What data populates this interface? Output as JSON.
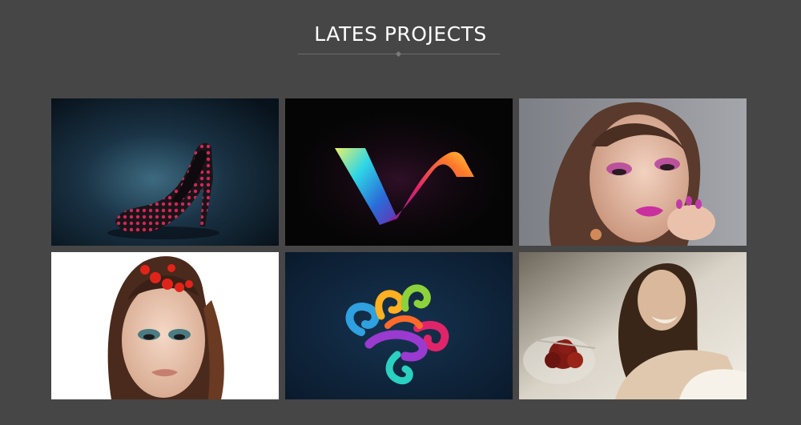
{
  "section": {
    "title": "LATES PROJECTS"
  },
  "projects": [
    {
      "subject": "high-heel-shoe",
      "background": "#0f1f2c"
    },
    {
      "subject": "gradient-v-logo",
      "background": "#050505"
    },
    {
      "subject": "makeup-portrait",
      "background": "#8a8c92"
    },
    {
      "subject": "hair-beads-portrait",
      "background": "#ffffff"
    },
    {
      "subject": "colorful-swirl-logo",
      "background": "#0c1e33"
    },
    {
      "subject": "bridal-portrait-sepia",
      "background": "#e8e2d8"
    }
  ]
}
